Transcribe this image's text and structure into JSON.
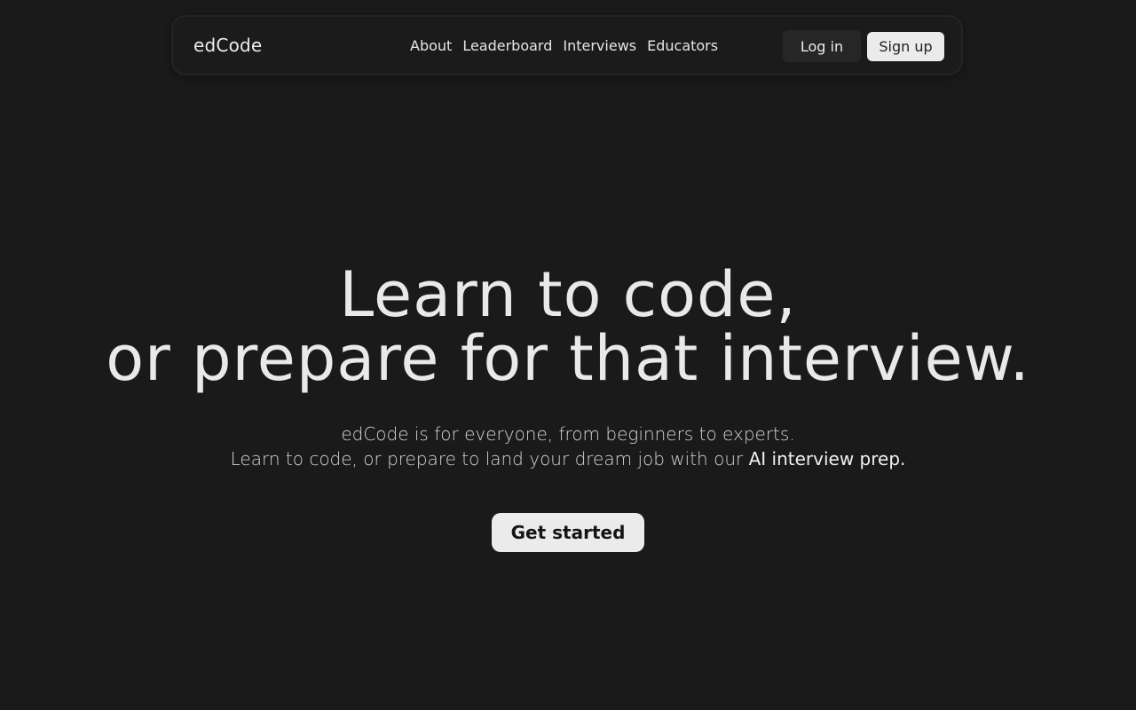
{
  "nav": {
    "brand": "edCode",
    "links": [
      {
        "label": "About"
      },
      {
        "label": "Leaderboard"
      },
      {
        "label": "Interviews"
      },
      {
        "label": "Educators"
      }
    ],
    "login_label": "Log in",
    "signup_label": "Sign up"
  },
  "hero": {
    "title_line1": "Learn to code,",
    "title_line2": "or prepare for that interview.",
    "subtitle_line1": "edCode is for everyone, from beginners to experts.",
    "subtitle_line2_prefix": "Learn to code, or prepare to land your dream job with our ",
    "subtitle_line2_highlight": "AI interview prep.",
    "cta_label": "Get started"
  },
  "colors": {
    "background": "#1a1a1a",
    "text": "#e9e9e9",
    "button_light": "#ebebeb",
    "button_dark": "#262626"
  }
}
